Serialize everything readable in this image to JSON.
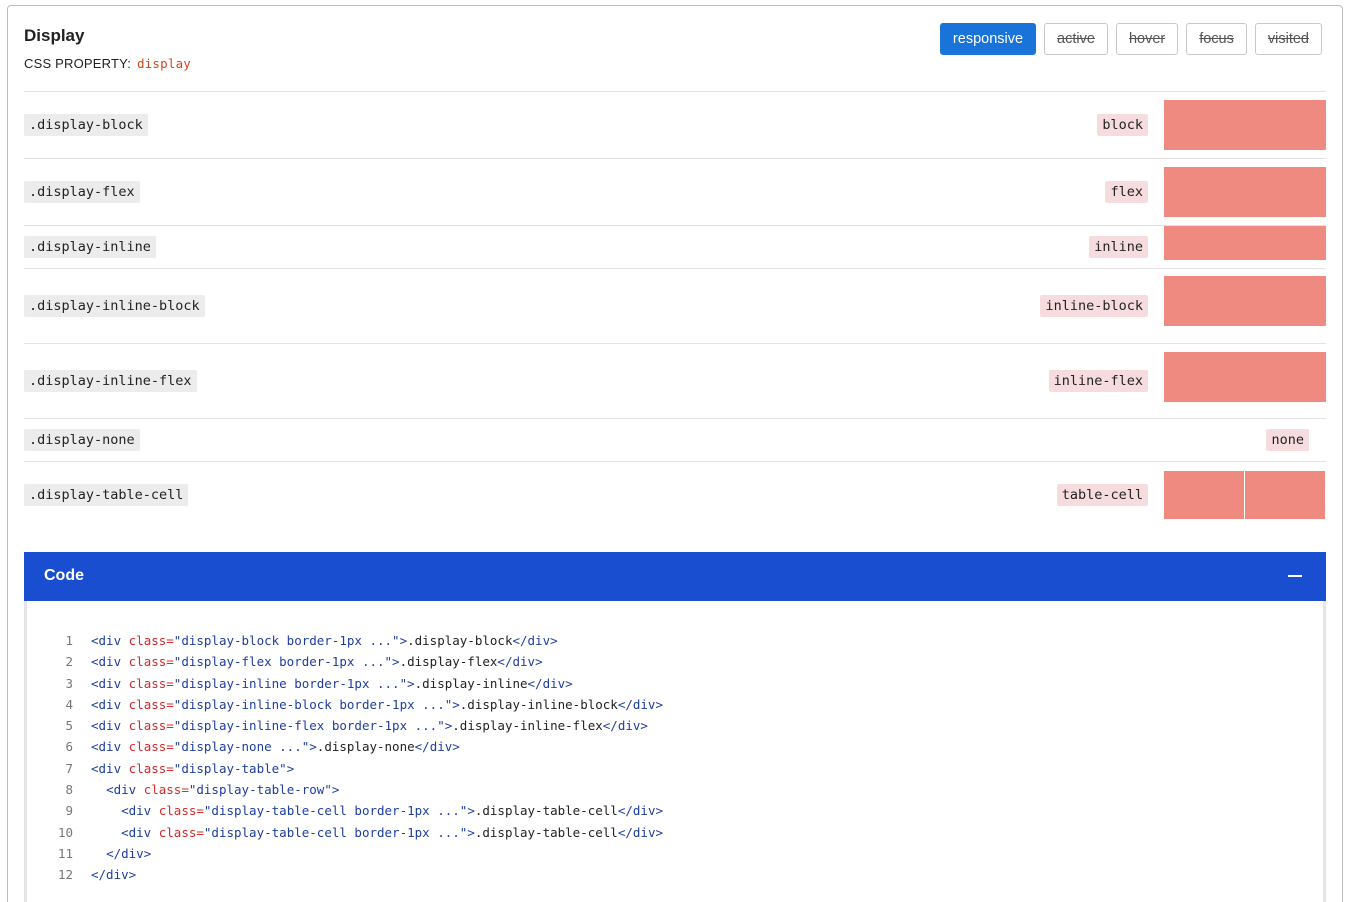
{
  "header": {
    "title": "Display",
    "property_label": "CSS PROPERTY:",
    "property_name": "display"
  },
  "variant_buttons": [
    "responsive",
    "active",
    "hover",
    "focus",
    "visited"
  ],
  "active_variant": "responsive",
  "rows": [
    {
      "class": ".display-block",
      "value": "block"
    },
    {
      "class": ".display-flex",
      "value": "flex"
    },
    {
      "class": ".display-inline",
      "value": "inline"
    },
    {
      "class": ".display-inline-block",
      "value": "inline-block"
    },
    {
      "class": ".display-inline-flex",
      "value": "inline-flex"
    },
    {
      "class": ".display-none",
      "value": "none"
    },
    {
      "class": ".display-table-cell",
      "value": "table-cell"
    }
  ],
  "code": {
    "title": "Code",
    "lines": [
      "<div class=\"display-block border-1px ...\">.display-block</div>",
      "<div class=\"display-flex border-1px ...\">.display-flex</div>",
      "<div class=\"display-inline border-1px ...\">.display-inline</div>",
      "<div class=\"display-inline-block border-1px ...\">.display-inline-block</div>",
      "<div class=\"display-inline-flex border-1px ...\">.display-inline-flex</div>",
      "<div class=\"display-none ...\">.display-none</div>",
      "<div class=\"display-table\">",
      "  <div class=\"display-table-row\">",
      "    <div class=\"display-table-cell border-1px ...\">.display-table-cell</div>",
      "    <div class=\"display-table-cell border-1px ...\">.display-table-cell</div>",
      "  </div>",
      "</div>"
    ]
  },
  "colors": {
    "accent": "#1a73d9",
    "code_header": "#1a4ed1",
    "swatch": "#ef8a80",
    "value_badge": "#f6dcdf",
    "property_text": "#d2461d"
  }
}
